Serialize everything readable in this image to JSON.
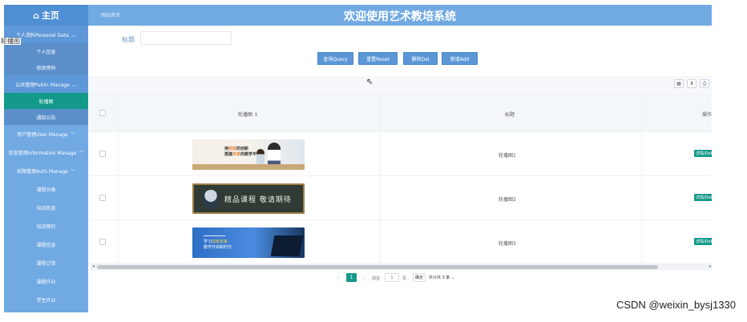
{
  "sidebar": {
    "home_label": "主页",
    "home_icon": "home-icon",
    "floating_tag": "轮播图",
    "groups": [
      {
        "label": "个人资料Personal Data",
        "subitems": [
          "个人信息",
          "修改密码"
        ]
      },
      {
        "label": "公共管理Public Manage",
        "subitems": [
          "轮播图",
          "通知公告"
        ]
      }
    ],
    "items": [
      {
        "label": "用户管理User Manage"
      },
      {
        "label": "信息管理Information Manage"
      },
      {
        "label": "权限管理Auth Manage"
      },
      {
        "label": "课程分类"
      },
      {
        "label": "培训信息"
      },
      {
        "label": "培训预约"
      },
      {
        "label": "课程信息"
      },
      {
        "label": "课程订单"
      },
      {
        "label": "课程作业"
      },
      {
        "label": "学生作业"
      }
    ]
  },
  "header": {
    "breadcrumb": "网站首页",
    "title": "欢迎使用艺术教培系统"
  },
  "search": {
    "label": "标题",
    "value": "",
    "placeholder": ""
  },
  "actions": {
    "query": "查询Query",
    "reset": "重置Reset",
    "delete": "删除Del",
    "add": "新增Add"
  },
  "table": {
    "columns": [
      "轮播图 ⇕",
      "标题",
      "操作"
    ],
    "rows": [
      {
        "title": "轮播图1",
        "action": "详情/Detail",
        "banner": {
          "line1_a": "用",
          "line1_hl": "科技",
          "line1_b": "的创新",
          "line2_a": "搭建",
          "line2_hl": "共享",
          "line2_b": "的教学平台"
        }
      },
      {
        "title": "轮播图2",
        "action": "详情/Detail",
        "banner": {
          "text": "精品课程  敬请期待"
        }
      },
      {
        "title": "轮播图3",
        "action": "详情/Detail",
        "banner": {
          "line0": "━━━━━━━━━",
          "line1": "学习",
          "line1_hl": "成就未来",
          "line2": "教学开启新时代"
        }
      }
    ]
  },
  "pagination": {
    "current_page": "1",
    "goto_label": "前往",
    "goto_value": "1",
    "unit": "页",
    "confirm": "确定",
    "total": "共计共 3 条 ⌄"
  },
  "watermark": "CSDN @weixin_bysj1330",
  "colors": {
    "sidebar": "#71a9e3",
    "primary_button": "#5b97d7",
    "active_teal": "#139a8a"
  }
}
